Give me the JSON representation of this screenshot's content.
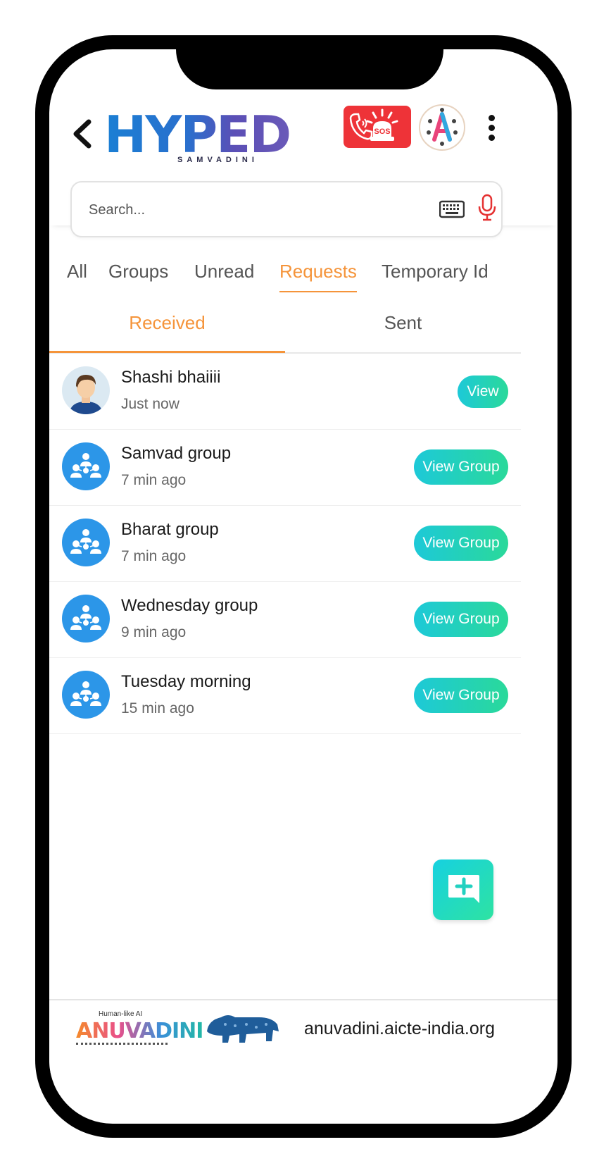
{
  "header": {
    "logo_text": "HYPED",
    "logo_subtitle": "SAMVADINI",
    "sos_label": "SOS"
  },
  "search": {
    "placeholder": "Search..."
  },
  "tabs": [
    {
      "label": "All"
    },
    {
      "label": "Groups"
    },
    {
      "label": "Unread"
    },
    {
      "label": "Requests"
    },
    {
      "label": "Temporary Id"
    }
  ],
  "active_tab": "Requests",
  "subtabs": [
    {
      "label": "Received"
    },
    {
      "label": "Sent"
    }
  ],
  "active_subtab": "Received",
  "requests": [
    {
      "name": "Shashi bhaiiii",
      "time": "Just now",
      "action": "View",
      "type": "person"
    },
    {
      "name": "Samvad group",
      "time": "7 min ago",
      "action": "View Group",
      "type": "group"
    },
    {
      "name": "Bharat group",
      "time": "7 min ago",
      "action": "View Group",
      "type": "group"
    },
    {
      "name": "Wednesday group",
      "time": "9 min ago",
      "action": "View Group",
      "type": "group"
    },
    {
      "name": "Tuesday morning",
      "time": "15 min ago",
      "action": "View Group",
      "type": "group"
    }
  ],
  "footer": {
    "anuvadini_tagline": "Human-like AI",
    "anuvadini_name": "ANUVADINI",
    "url": "anuvadini.aicte-india.org"
  },
  "colors": {
    "accent_orange": "#f5943a",
    "avatar_blue": "#2c96e8",
    "button_gradient_start": "#1dc9d8",
    "button_gradient_end": "#2ad99a",
    "sos_red": "#ee3338"
  },
  "icons": {
    "back": "chevron-left-icon",
    "sos": "sos-siren-icon",
    "language": "language-icon",
    "menu": "more-vertical-icon",
    "keyboard": "keyboard-icon",
    "mic": "mic-icon",
    "group": "group-icon",
    "fab": "new-chat-icon"
  }
}
